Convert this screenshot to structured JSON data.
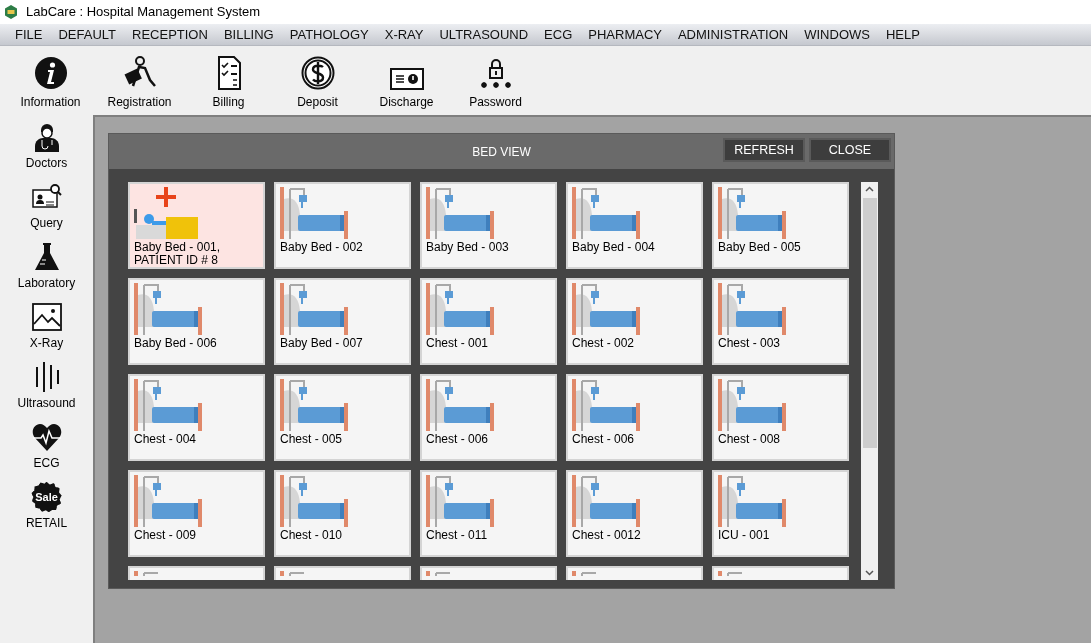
{
  "window": {
    "title": "LabCare : Hospital Management System"
  },
  "menu": [
    "FILE",
    "DEFAULT",
    "RECEPTION",
    "BILLING",
    "PATHOLOGY",
    "X-RAY",
    "ULTRASOUND",
    "ECG",
    "PHARMACY",
    "ADMINISTRATION",
    "WINDOWS",
    "HELP"
  ],
  "toolbar": [
    {
      "kind": "info",
      "label": "Information"
    },
    {
      "kind": "registration",
      "label": "Registration"
    },
    {
      "kind": "billing",
      "label": "Billing"
    },
    {
      "kind": "deposit",
      "label": "Deposit"
    },
    {
      "kind": "discharge",
      "label": "Discharge"
    },
    {
      "kind": "password",
      "label": "Password"
    }
  ],
  "sidebar": [
    {
      "kind": "doctors",
      "label": "Doctors"
    },
    {
      "kind": "query",
      "label": "Query"
    },
    {
      "kind": "lab",
      "label": "Laboratory"
    },
    {
      "kind": "xray",
      "label": "X-Ray"
    },
    {
      "kind": "ultrasound",
      "label": "Ultrasound"
    },
    {
      "kind": "ecg",
      "label": "ECG"
    },
    {
      "kind": "sale",
      "label": "RETAIL",
      "badge": "Sale"
    }
  ],
  "bed_view": {
    "title": "BED VIEW",
    "buttons": [
      "REFRESH",
      "CLOSE"
    ],
    "beds": [
      {
        "label": "Baby Bed - 001,\nPATIENT ID # 8",
        "occupied": true
      },
      {
        "label": "Baby Bed - 002",
        "occupied": false
      },
      {
        "label": "Baby Bed - 003",
        "occupied": false
      },
      {
        "label": "Baby Bed - 004",
        "occupied": false
      },
      {
        "label": "Baby Bed - 005",
        "occupied": false
      },
      {
        "label": "Baby Bed - 006",
        "occupied": false
      },
      {
        "label": "Baby Bed - 007",
        "occupied": false
      },
      {
        "label": "Chest - 001",
        "occupied": false
      },
      {
        "label": "Chest - 002",
        "occupied": false
      },
      {
        "label": "Chest - 003",
        "occupied": false
      },
      {
        "label": "Chest - 004",
        "occupied": false
      },
      {
        "label": "Chest - 005",
        "occupied": false
      },
      {
        "label": "Chest - 006",
        "occupied": false
      },
      {
        "label": "Chest - 006",
        "occupied": false
      },
      {
        "label": "Chest - 008",
        "occupied": false
      },
      {
        "label": "Chest - 009",
        "occupied": false
      },
      {
        "label": "Chest - 010",
        "occupied": false
      },
      {
        "label": "Chest - 011",
        "occupied": false
      },
      {
        "label": "Chest - 0012",
        "occupied": false
      },
      {
        "label": "ICU - 001",
        "occupied": false
      },
      {
        "occupied": false
      },
      {
        "occupied": false
      },
      {
        "occupied": false
      },
      {
        "occupied": false
      },
      {
        "occupied": false
      }
    ]
  }
}
